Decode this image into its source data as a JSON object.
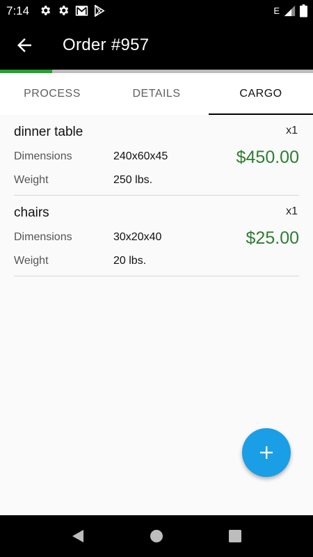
{
  "status_bar": {
    "time": "7:14",
    "network_label": "E",
    "icons": [
      "gear-icon",
      "gear-icon",
      "mail-icon",
      "play-store-icon",
      "signal-icon",
      "battery-icon"
    ]
  },
  "app_bar": {
    "title": "Order #957",
    "back_icon": "arrow-back-icon"
  },
  "progress": {
    "fraction": 0.167,
    "color": "#1fa52b"
  },
  "tabs": [
    {
      "label": "PROCESS",
      "active": false
    },
    {
      "label": "DETAILS",
      "active": false
    },
    {
      "label": "CARGO",
      "active": true
    }
  ],
  "cargo": [
    {
      "name": "dinner table",
      "quantity": "x1",
      "dimensions_label": "Dimensions",
      "dimensions": "240x60x45",
      "weight_label": "Weight",
      "weight": "250 lbs.",
      "price": "$450.00"
    },
    {
      "name": "chairs",
      "quantity": "x1",
      "dimensions_label": "Dimensions",
      "dimensions": "30x20x40",
      "weight_label": "Weight",
      "weight": "20 lbs.",
      "price": "$25.00"
    }
  ],
  "fab": {
    "icon": "plus-icon",
    "color": "#1a9ee6"
  },
  "nav_bar": {
    "icons": [
      "back-triangle-icon",
      "home-circle-icon",
      "recents-square-icon"
    ]
  }
}
